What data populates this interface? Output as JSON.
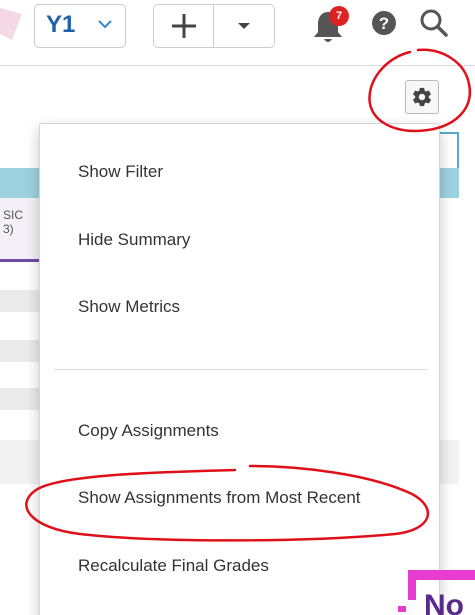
{
  "header": {
    "year_label": "Y1",
    "notification_count": "7",
    "icons": {
      "year_dropdown": "chevron-down-icon",
      "add": "plus-icon",
      "add_menu": "caret-down-icon",
      "notifications": "bell-icon",
      "help": "help-circle-icon",
      "search": "search-icon"
    }
  },
  "toolbar": {
    "settings_icon": "gear-icon"
  },
  "background": {
    "card_text": "SIC\n3)"
  },
  "settings_menu": {
    "items": [
      {
        "label": "Show Filter"
      },
      {
        "label": "Hide Summary"
      },
      {
        "label": "Show Metrics"
      },
      {
        "label": "Copy Assignments"
      },
      {
        "label": "Show Assignments from Most Recent"
      },
      {
        "label": "Recalculate Final Grades"
      }
    ]
  },
  "corner_logo_text": "No",
  "colors": {
    "brand_blue": "#1e63a8",
    "badge_red": "#dd2222",
    "annotation_red": "#e0101a",
    "logo_magenta": "#e63ccf",
    "logo_purple": "#5a2a8a"
  }
}
